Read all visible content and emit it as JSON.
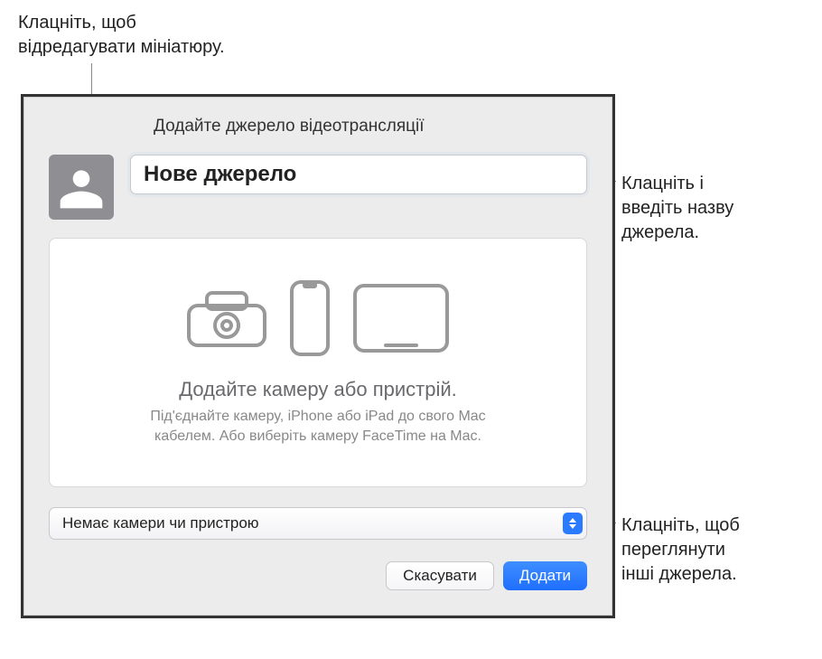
{
  "callouts": {
    "top": "Клацніть, щоб\nвідредагувати мініатюру.",
    "right_top": "Клацніть і\nвведіть назву\nджерела.",
    "right_bottom": "Клацніть, щоб\nпереглянути\nінші джерела."
  },
  "dialog": {
    "title": "Додайте джерело відеотрансляції",
    "name_value": "Нове джерело",
    "preview_heading": "Додайте камеру або пристрій.",
    "preview_subtext": "Під'єднайте камеру, iPhone або iPad до свого Mac кабелем. Або виберіть камеру FaceTime на Mac.",
    "select_value": "Немає камери чи пристрою",
    "cancel_label": "Скасувати",
    "add_label": "Додати"
  }
}
